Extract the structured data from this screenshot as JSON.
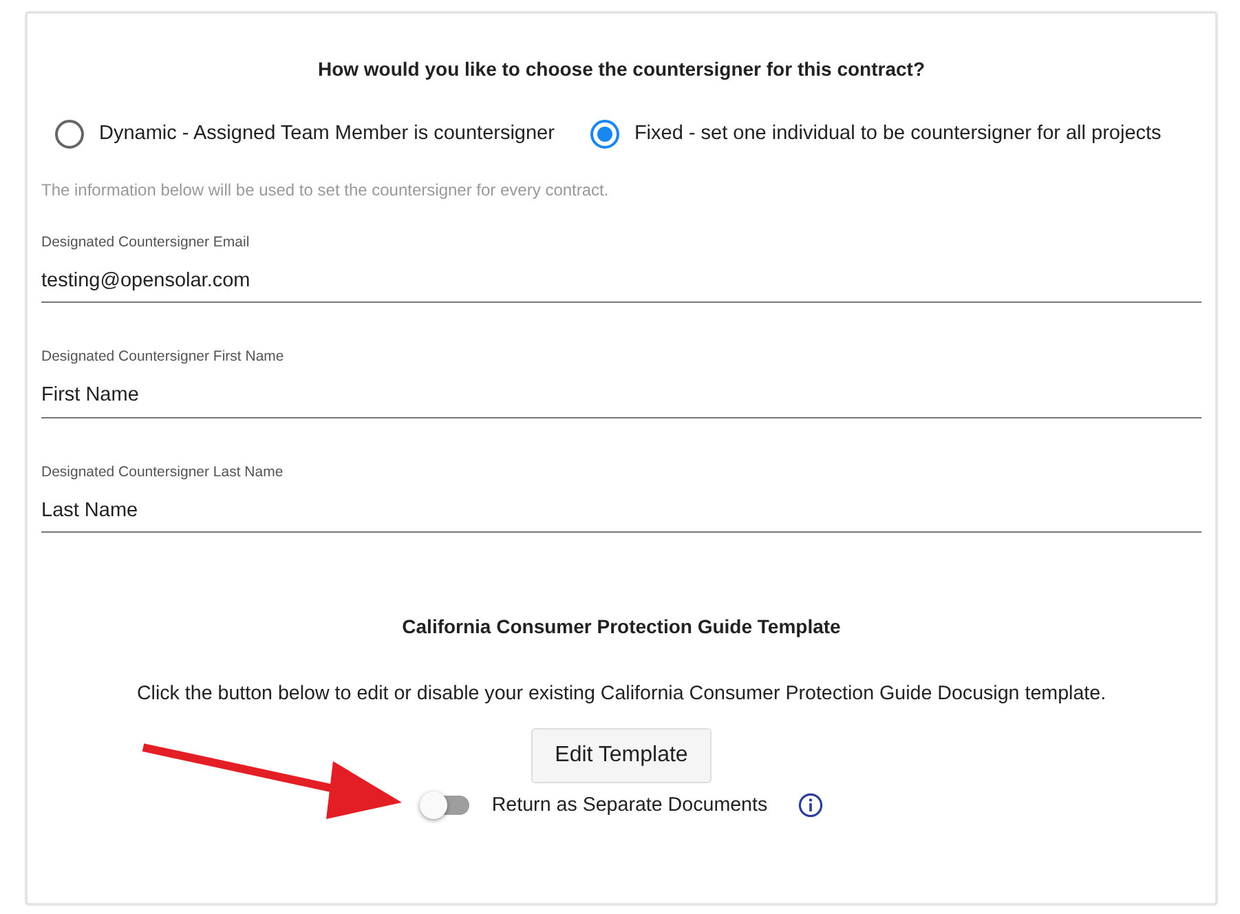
{
  "heading": "How would you like to choose the countersigner for this contract?",
  "options": [
    {
      "label": "Dynamic - Assigned Team Member is countersigner",
      "selected": false
    },
    {
      "label": "Fixed - set one individual to be countersigner for all projects",
      "selected": true
    }
  ],
  "hint": "The information below will be used to set the countersigner for every contract.",
  "fields": [
    {
      "label": "Designated Countersigner Email",
      "value": "testing@opensolar.com"
    },
    {
      "label": "Designated Countersigner First Name",
      "value": "First Name"
    },
    {
      "label": "Designated Countersigner Last Name",
      "value": "Last Name"
    }
  ],
  "template": {
    "title": "California Consumer Protection Guide Template",
    "description": "Click the button below to edit or disable your existing California Consumer Protection Guide Docusign template.",
    "button": "Edit Template"
  },
  "toggle": {
    "label": "Return as Separate Documents",
    "on": false
  }
}
